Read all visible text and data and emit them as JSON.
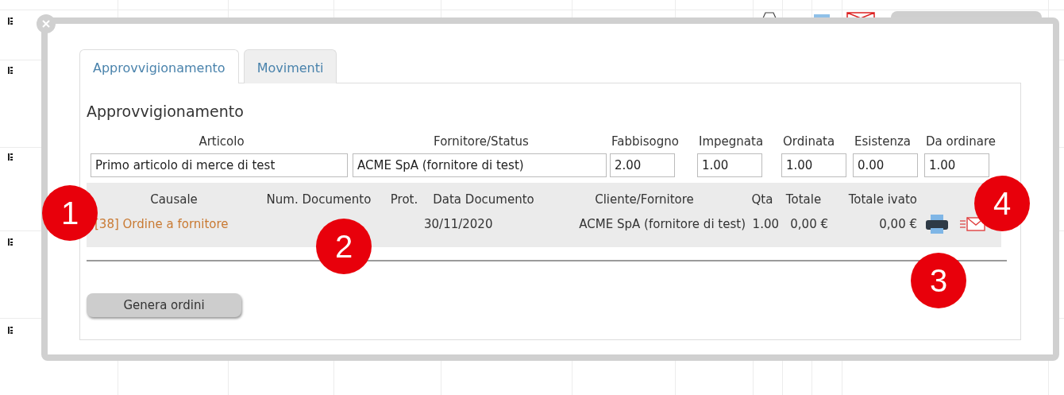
{
  "tabs": [
    {
      "label": "Approvvigionamento",
      "selected": true
    },
    {
      "label": "Movimenti",
      "selected": false
    }
  ],
  "section_title": "Approvvigionamento",
  "supply": {
    "columns": [
      "Articolo",
      "Fornitore/Status",
      "Fabbisogno",
      "Impegnata",
      "Ordinata",
      "Esistenza",
      "Da ordinare"
    ],
    "values": [
      "Primo articolo di merce di test",
      "ACME SpA (fornitore di test)",
      "2.00",
      "1.00",
      "1.00",
      "0.00",
      "1.00"
    ]
  },
  "movements": {
    "columns": [
      "Causale",
      "Num. Documento",
      "Prot.",
      "Data Documento",
      "Cliente/Fornitore",
      "Qta",
      "Totale",
      "Totale ivato"
    ],
    "rows": [
      {
        "causale": "[38] Ordine a fornitore",
        "data_documento": "30/11/2020",
        "cliente_fornitore": "ACME SpA (fornitore di test)",
        "qta": "1.00",
        "totale": "0,00 €",
        "totale_ivato": "0,00 €"
      }
    ]
  },
  "button": "Genera ordini",
  "markers": [
    "1",
    "2",
    "3",
    "4"
  ]
}
